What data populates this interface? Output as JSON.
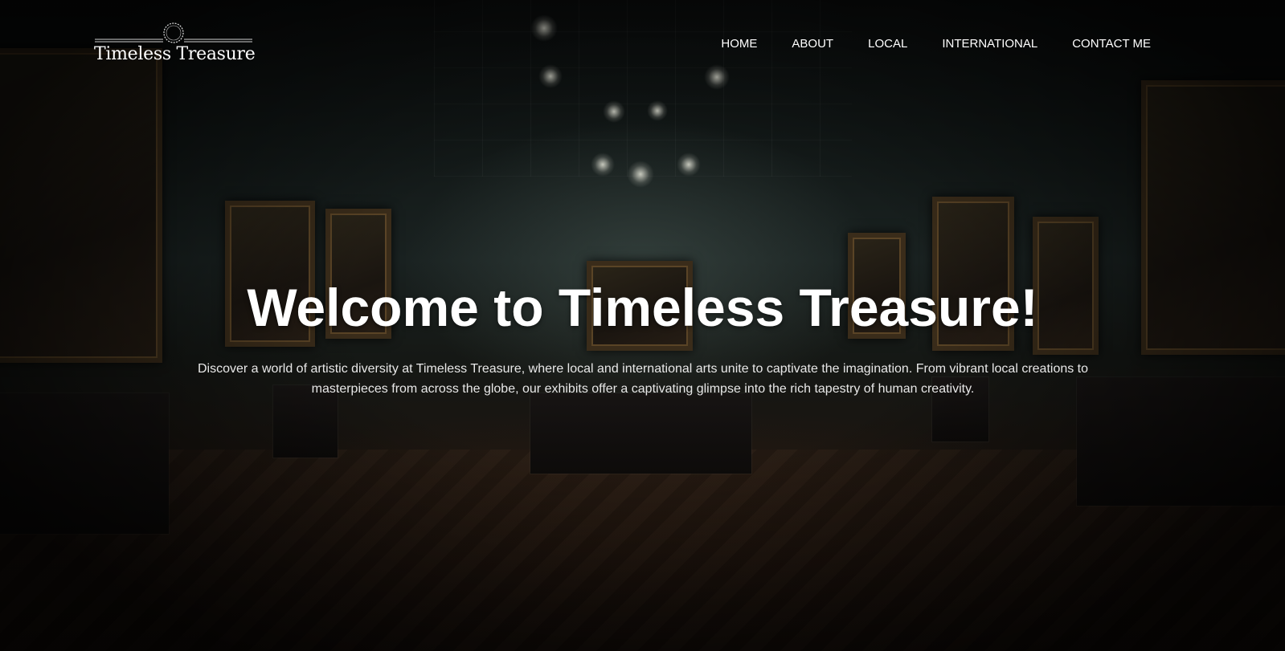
{
  "brand": {
    "name": "Timeless Treasure"
  },
  "nav": {
    "items": [
      "HOME",
      "ABOUT",
      "LOCAL",
      "INTERNATIONAL",
      "CONTACT ME"
    ]
  },
  "hero": {
    "headline": "Welcome to Timeless Treasure!",
    "description": "Discover a world of artistic diversity at Timeless Treasure, where local and international arts unite to captivate the imagination. From vibrant local creations to masterpieces from across the globe, our exhibits offer a captivating glimpse into the rich tapestry of human creativity."
  },
  "icons": {
    "logo": "clock-logo-icon"
  },
  "colors": {
    "text": "#ffffff",
    "background": "#0b0c0c"
  }
}
